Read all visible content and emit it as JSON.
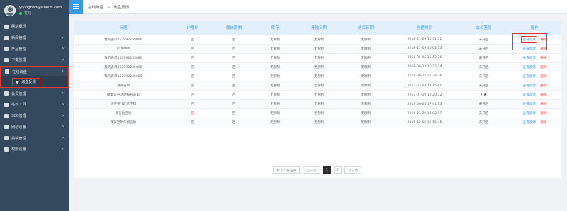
{
  "profile": {
    "name": "yiyingbao@sinoim.com",
    "status": "在线",
    "status_color": "#2ecc71"
  },
  "menu": [
    {
      "label": "网站概况",
      "icon": "home-icon",
      "arrow": ""
    },
    {
      "label": "新闻管理",
      "icon": "news-icon",
      "arrow": ">"
    },
    {
      "label": "产品管理",
      "icon": "product-icon",
      "arrow": ">"
    },
    {
      "label": "下载管理",
      "icon": "download-icon",
      "arrow": ">"
    },
    {
      "label": "在线询盘",
      "icon": "inquiry-icon",
      "arrow": "∨"
    },
    {
      "label": "询盘反馈",
      "icon": "send-icon",
      "arrow": ""
    },
    {
      "label": "会员管理",
      "icon": "member-icon",
      "arrow": ">"
    },
    {
      "label": "站长工具",
      "icon": "tools-icon",
      "arrow": ">"
    },
    {
      "label": "SEO管理",
      "icon": "seo-icon",
      "arrow": ">"
    },
    {
      "label": "网站设置",
      "icon": "settings-icon",
      "arrow": ">"
    },
    {
      "label": "投稿管理",
      "icon": "submission-icon",
      "arrow": ">"
    },
    {
      "label": "权限设置",
      "icon": "permission-icon",
      "arrow": ">"
    }
  ],
  "breadcrumb": {
    "parent": "在线询盘",
    "separator": ">",
    "current": "询盘反馈"
  },
  "table": {
    "headers": [
      "标题",
      "IP限制",
      "微信限制",
      "库存",
      "开始日期",
      "结束日期",
      "创建时间",
      "会议签到",
      "操作"
    ],
    "view_label": "查看反馈",
    "delete_label": "删除",
    "rows": [
      [
        "我的表单152992235086",
        "否",
        "否",
        "无限制",
        "无限制",
        "无限制",
        "2018-11-29 15:51:52",
        "未开启"
      ],
      [
        "yr-index",
        "否",
        "否",
        "无限制",
        "无限制",
        "无限制",
        "2018-11-19 16:01:13",
        "未开启"
      ],
      [
        "我的表单152992235086",
        "否",
        "否",
        "无限制",
        "无限制",
        "无限制",
        "2018-06-05 16:12:26",
        "未开启"
      ],
      [
        "我的表单152992235085",
        "否",
        "否",
        "无限制",
        "无限制",
        "无限制",
        "2018-06-22 16:22:24",
        "未开启"
      ],
      [
        "我的表单152992235086",
        "否",
        "否",
        "无限制",
        "无限制",
        "无限制",
        "2018-06-22 15:24:36",
        "未开启"
      ],
      [
        "测试表单",
        "否",
        "否",
        "无限制",
        "无限制",
        "无限制",
        "2017-07-03 13:15:01",
        "未开启"
      ],
      [
        "储蓄证券活动报名表单",
        "否",
        "否",
        "无限制",
        "无限制",
        "无限制",
        "2017-07-10 10:20:32",
        "打开"
      ],
      [
        "请完整\"疑\"这不得",
        "否",
        "否",
        "无限制",
        "无限制",
        "无限制",
        "2017-06-05 17:41:13",
        "未开启"
      ],
      [
        "留言板咨询",
        "是",
        "否",
        "无限制",
        "无限制",
        "无限制",
        "2016-11-29 10:02:17",
        "未开启"
      ],
      [
        "预览宝制作留言板",
        "否",
        "否",
        "无限制",
        "无限制",
        "无限制",
        "2015-12-02 15:15:45",
        "未开启"
      ]
    ]
  },
  "pagination": {
    "total": "共 12 条记录",
    "prev": "上一页",
    "pages": [
      "1",
      "2"
    ],
    "current": "1",
    "next": "下一页"
  },
  "colors": {
    "accent": "#3a9ae8",
    "sidebar": "#34495e",
    "highlight": "#e53935"
  }
}
